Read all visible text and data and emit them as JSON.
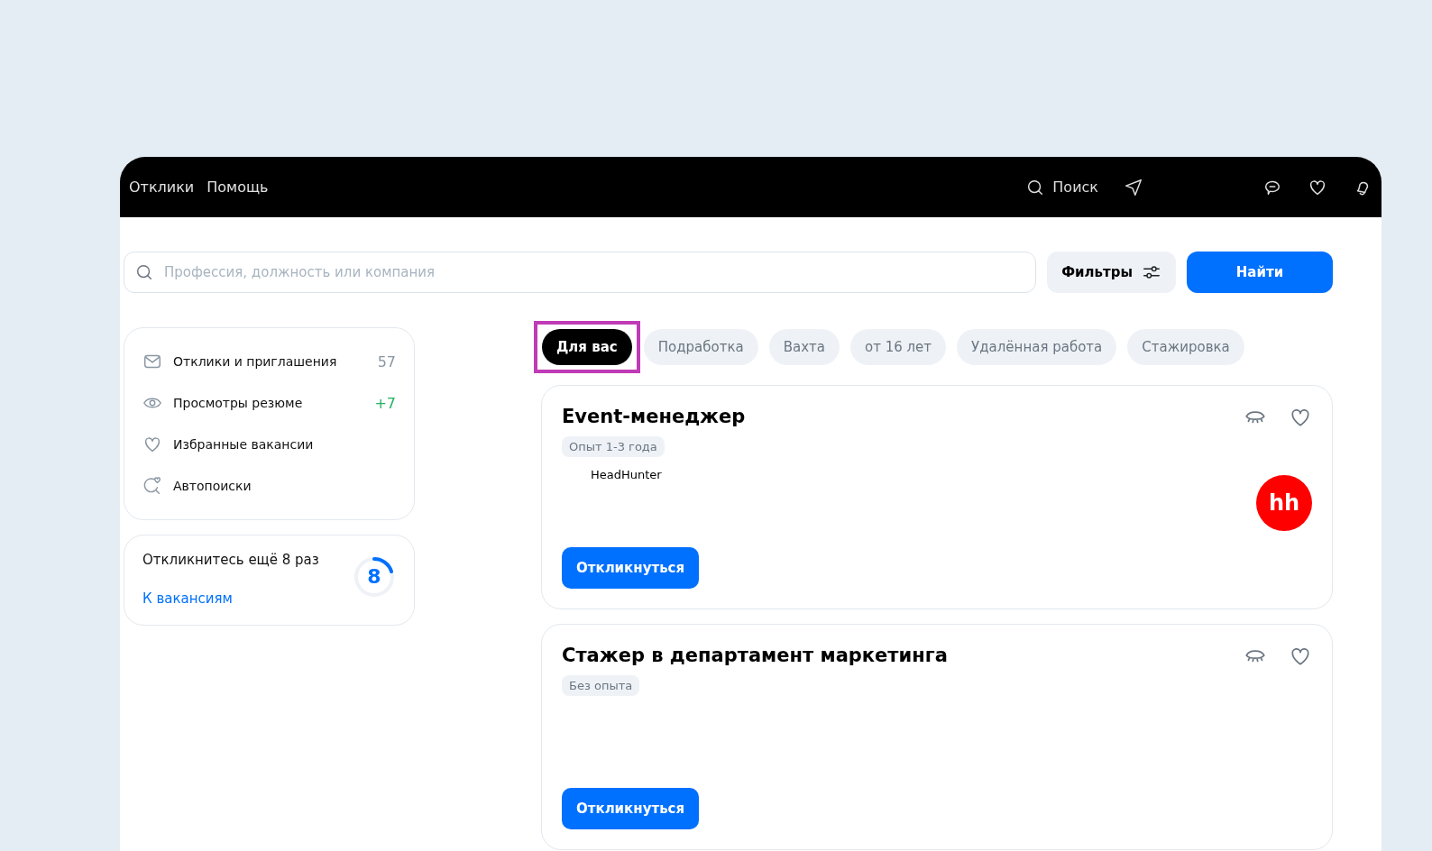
{
  "header": {
    "links": [
      "Отклики",
      "Помощь"
    ],
    "search_label": "Поиск"
  },
  "search": {
    "placeholder": "Профессия, должность или компания",
    "filters_label": "Фильтры",
    "submit_label": "Найти"
  },
  "sidebar": {
    "items": [
      {
        "kind": "mail",
        "label": "Отклики и приглашения",
        "count": "57",
        "color": "#8a96a3"
      },
      {
        "kind": "eye",
        "label": "Просмотры резюме",
        "count": "+7",
        "color": "#22b35e"
      },
      {
        "kind": "heart",
        "label": "Избранные вакансии"
      },
      {
        "kind": "autosearch",
        "label": "Автопоиски"
      }
    ],
    "promo": {
      "text": "Откликнитесь ещё 8 раз",
      "link": "К вакансиям",
      "ring_value": "8",
      "level": 0.2
    }
  },
  "chips": [
    {
      "label": "Для вас",
      "selected": true,
      "highlighted": true
    },
    {
      "label": "Подработка",
      "selected": false,
      "highlighted": false
    },
    {
      "label": "Вахта",
      "selected": false,
      "highlighted": false
    },
    {
      "label": "от 16 лет",
      "selected": false,
      "highlighted": false
    },
    {
      "label": "Удалённая работа",
      "selected": false,
      "highlighted": false
    },
    {
      "label": "Стажировка",
      "selected": false,
      "highlighted": false
    }
  ],
  "vacancies": [
    {
      "title": "Event-менеджер",
      "experience": "Опыт 1-3 года",
      "company": "HeadHunter",
      "logo_text": "hh",
      "apply_label": "Откликнуться"
    },
    {
      "title": "Стажер в департамент маркетинга",
      "experience": "Без опыта",
      "apply_label": "Откликнуться"
    }
  ]
}
